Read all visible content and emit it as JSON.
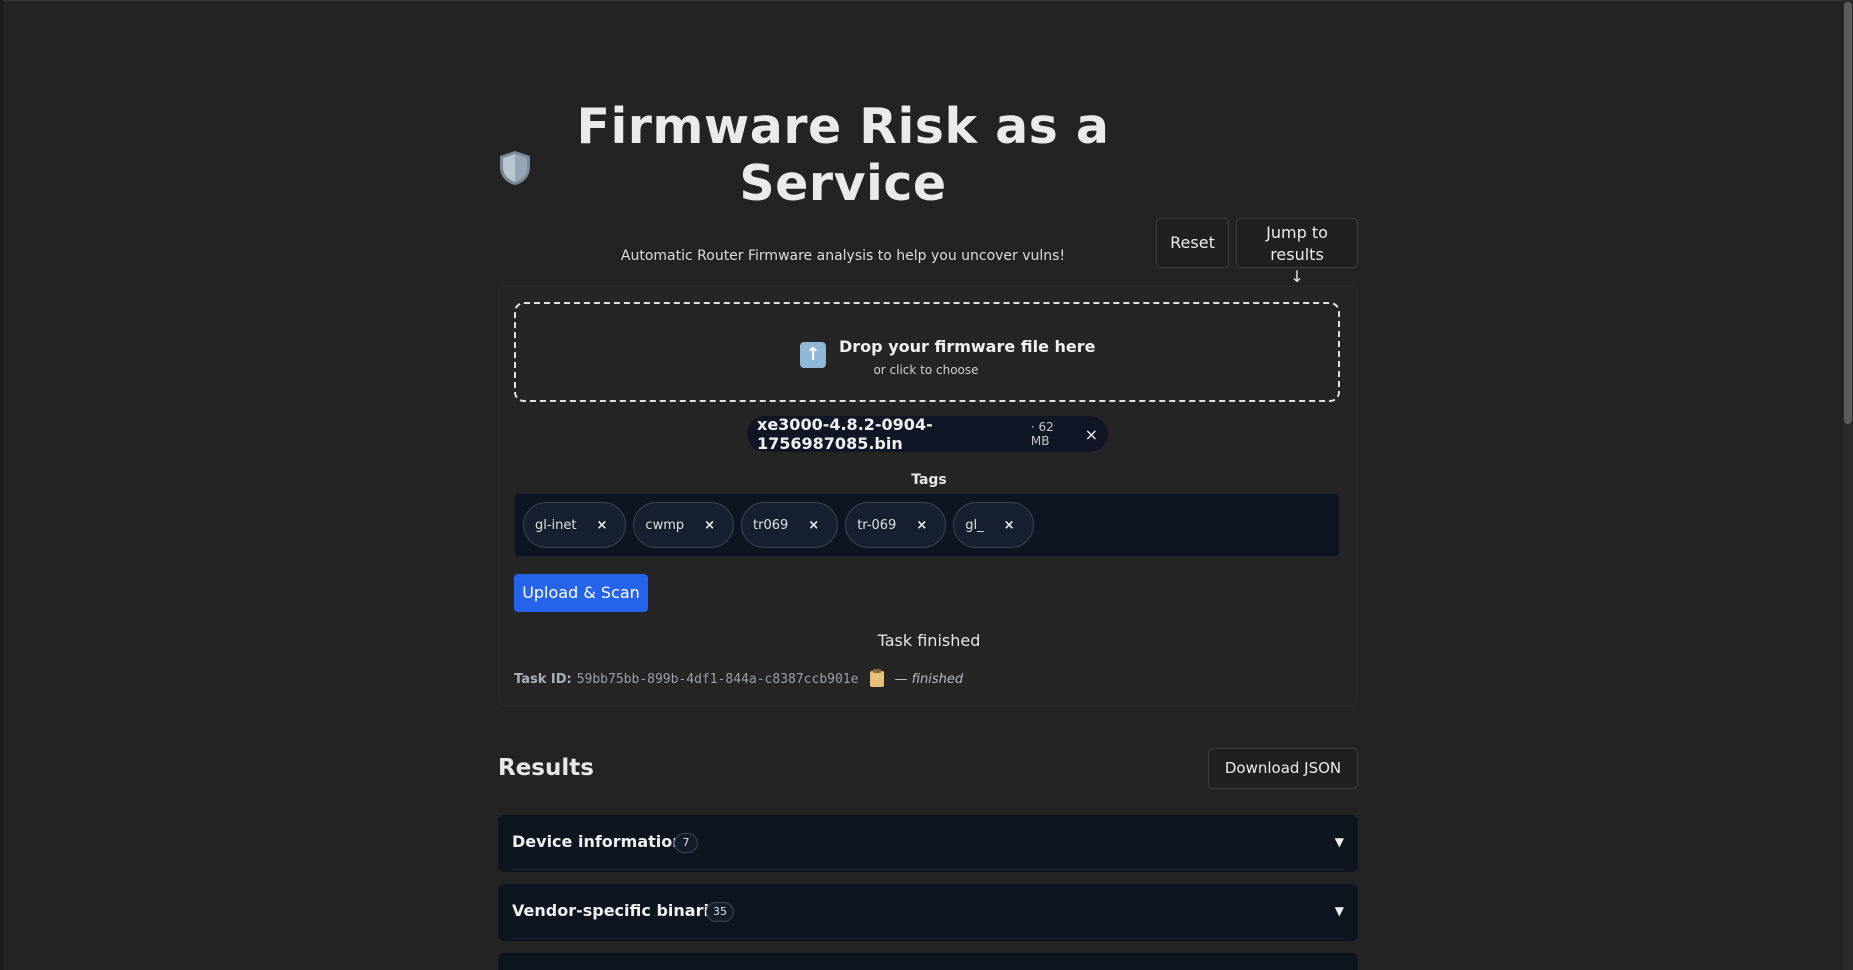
{
  "header": {
    "title": "Firmware Risk as a Service",
    "subtitle": "Automatic Router Firmware analysis to help you uncover vulns!",
    "shield_icon": "shield-icon",
    "reset_label": "Reset",
    "jump_label": "Jump to results",
    "jump_arrow": "↓"
  },
  "upload": {
    "drop_title": "Drop your firmware file here",
    "drop_sub": "or click to choose",
    "drop_icon": "upload-arrow-icon",
    "file": {
      "name": "xe3000-4.8.2-0904-1756987085.bin",
      "size": "· 62 MB",
      "remove": "×"
    },
    "tags_label": "Tags",
    "tags": [
      {
        "label": "gl-inet",
        "remove": "×"
      },
      {
        "label": "cwmp",
        "remove": "×"
      },
      {
        "label": "tr069",
        "remove": "×"
      },
      {
        "label": "tr-069",
        "remove": "×"
      },
      {
        "label": "gl_",
        "remove": "×"
      }
    ],
    "upload_button": "Upload & Scan",
    "task_status": "Task finished",
    "task_label": "Task ID:",
    "task_id": "59bb75bb-899b-4df1-844a-c8387ccb901e",
    "task_state": "— finished"
  },
  "results": {
    "title": "Results",
    "download_label": "Download JSON",
    "sections": [
      {
        "title": "Device informations",
        "count": "7",
        "caret": "▼"
      },
      {
        "title": "Vendor-specific binaries",
        "count": "35",
        "caret": "▼"
      },
      {
        "title": "",
        "count": "",
        "caret": ""
      }
    ]
  },
  "colors": {
    "background": "#232323",
    "accent": "#2563eb",
    "panel": "#0d1520"
  }
}
